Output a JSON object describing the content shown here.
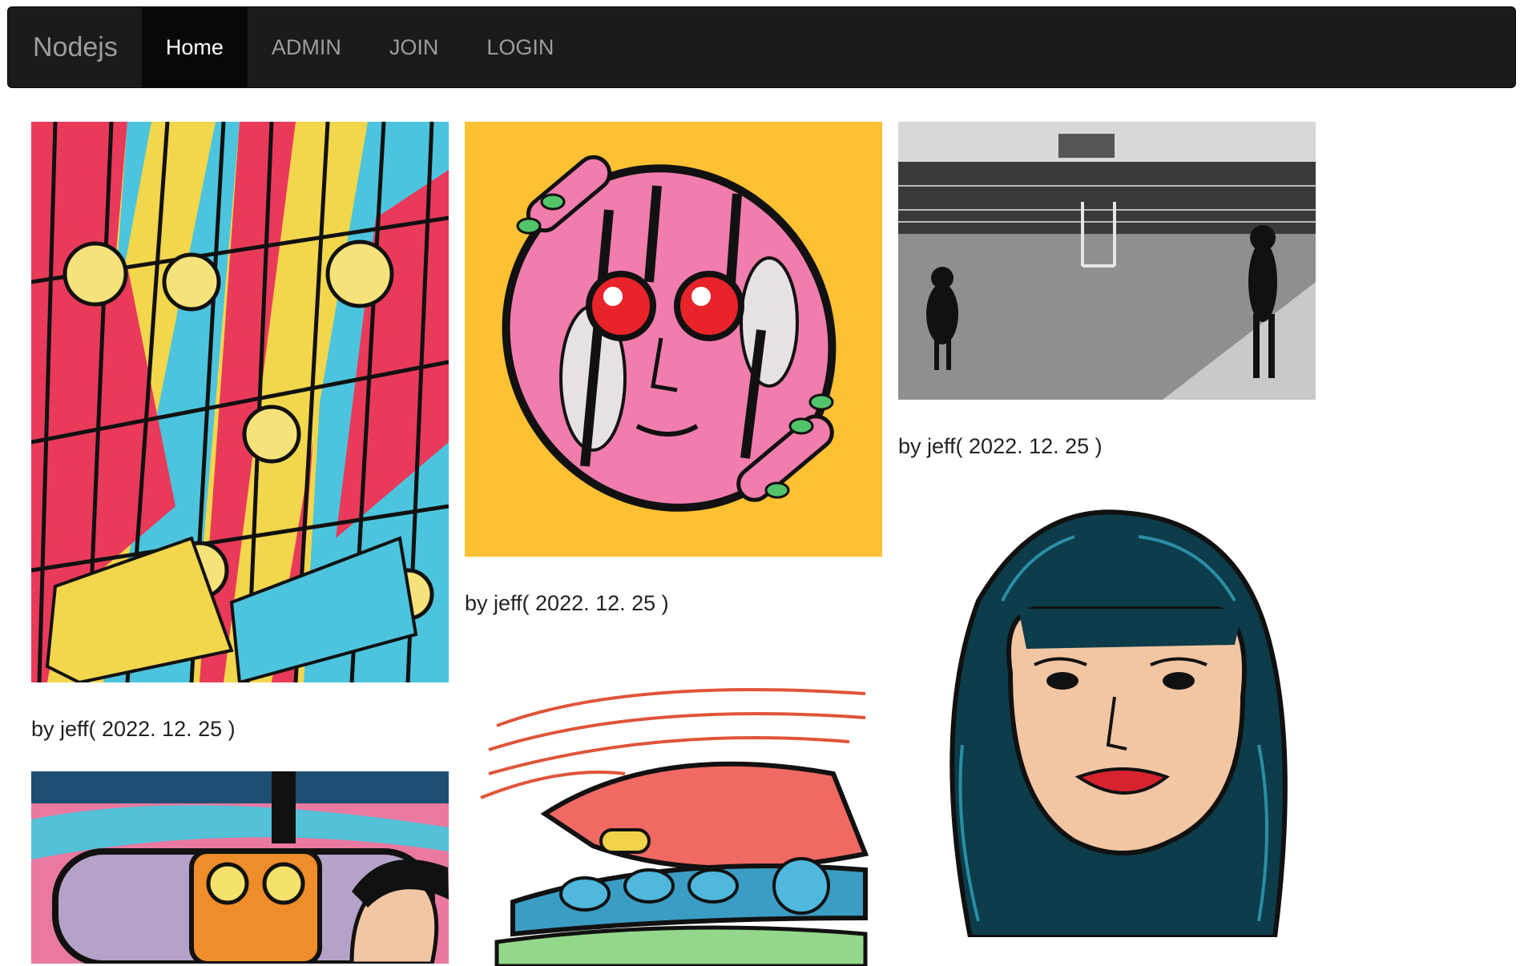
{
  "navbar": {
    "brand": "Nodejs",
    "items": [
      {
        "label": "Home",
        "active": true
      },
      {
        "label": "ADMIN",
        "active": false
      },
      {
        "label": "JOIN",
        "active": false
      },
      {
        "label": "LOGIN",
        "active": false
      }
    ]
  },
  "posts": [
    {
      "caption": "by jeff( 2022. 12. 25 )"
    },
    {
      "caption": "by jeff( 2022. 12. 25 )"
    },
    {
      "caption": "by jeff( 2022. 12. 25 )"
    }
  ],
  "colors": {
    "navbar_bg": "#1b1b1b",
    "nav_active_bg": "#080808",
    "nav_text": "#9d9d9d",
    "nav_active_text": "#ffffff"
  }
}
